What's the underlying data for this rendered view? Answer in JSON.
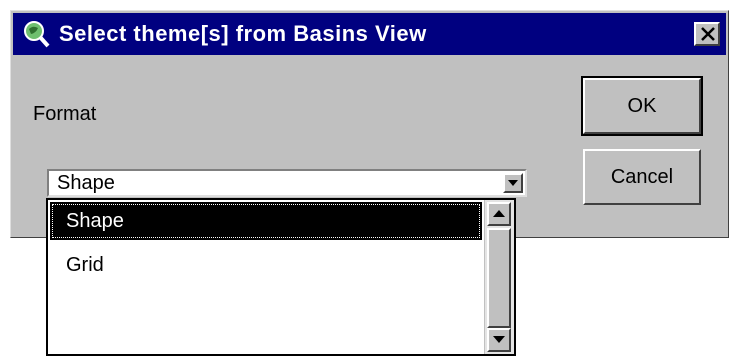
{
  "window": {
    "title": "Select theme[s] from Basins View",
    "icon": "magnifier-globe-icon",
    "close_icon": "close-icon"
  },
  "form": {
    "format_label": "Format",
    "combo_value": "Shape"
  },
  "buttons": {
    "ok_label": "OK",
    "cancel_label": "Cancel"
  },
  "dropdown": {
    "items": [
      {
        "label": "Shape",
        "selected": true
      },
      {
        "label": "Grid",
        "selected": false
      }
    ]
  },
  "colors": {
    "titlebar": "#000080",
    "face": "#c0c0c0",
    "selection": "#000000"
  }
}
